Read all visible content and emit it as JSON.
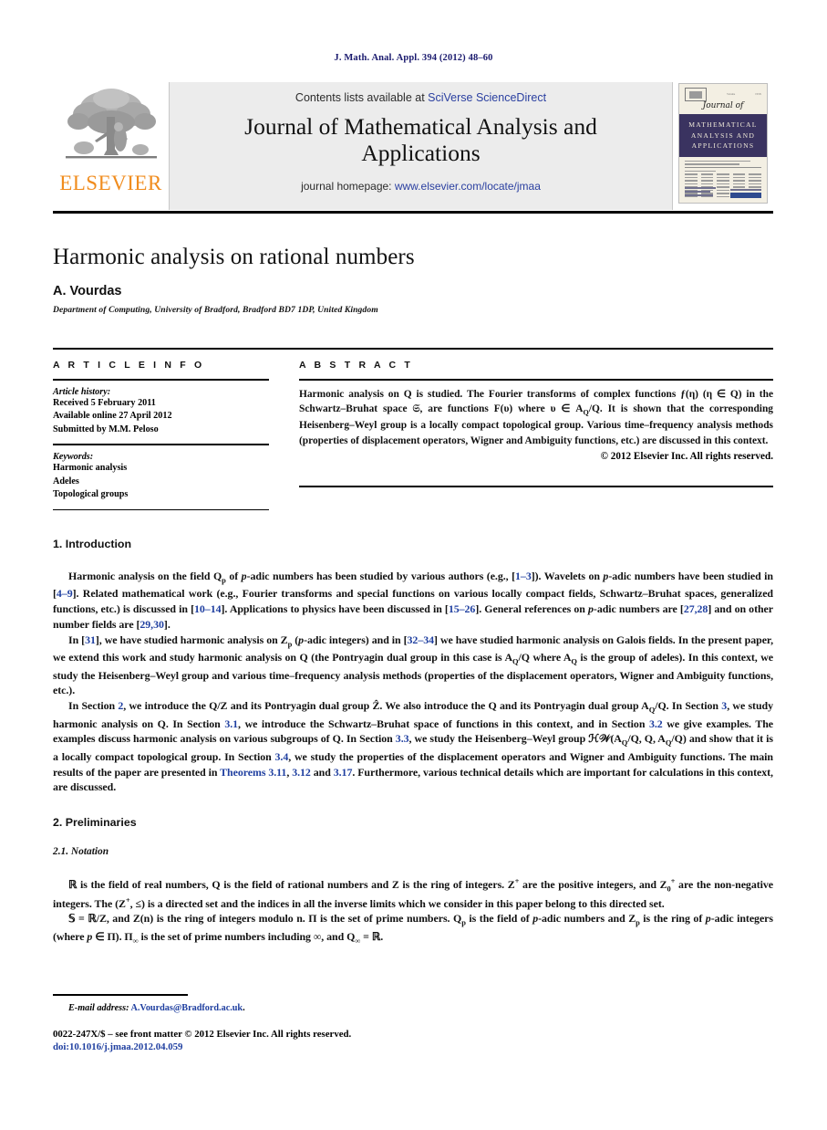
{
  "running_head": "J. Math. Anal. Appl. 394 (2012) 48–60",
  "masthead": {
    "publisher_name": "ELSEVIER",
    "publisher_logo": "elsevier-tree-logo",
    "contents_prefix": "Contents lists available at ",
    "contents_link": "SciVerse ScienceDirect",
    "journal_title": "Journal of Mathematical Analysis and Applications",
    "homepage_prefix": "journal homepage: ",
    "homepage_link": "www.elsevier.com/locate/jmaa",
    "cover": {
      "script_word": "Journal of",
      "band_line1": "MATHEMATICAL",
      "band_line2": "ANALYSIS AND",
      "band_line3": "APPLICATIONS",
      "band_color": "#3a3360",
      "paper_color": "#f3efe3"
    }
  },
  "article": {
    "title": "Harmonic analysis on rational numbers",
    "author": "A. Vourdas",
    "affiliation": "Department of Computing, University of Bradford, Bradford BD7 1DP, United Kingdom"
  },
  "article_info": {
    "heading": "A R T I C L E   I N F O",
    "history_heading": "Article history:",
    "history_lines": [
      "Received 5 February 2011",
      "Available online 27 April 2012",
      "Submitted by M.M. Peloso"
    ],
    "keywords_heading": "Keywords:",
    "keywords": [
      "Harmonic analysis",
      "Adeles",
      "Topological groups"
    ]
  },
  "abstract": {
    "heading": "A B S T R A C T",
    "text_parts": {
      "p1": "Harmonic analysis on Q is studied. The Fourier transforms of complex functions ƒ(η) (η ∈ Q) in the Schwartz–Bruhat space 𝔖, are functions F(υ) where υ ∈ A",
      "p1_sub": "Q",
      "p2": "/Q. It is shown that the corresponding Heisenberg–Weyl group is a locally compact topological group. Various time–frequency analysis methods (properties of displacement operators, Wigner and Ambiguity functions, etc.) are discussed in this context."
    },
    "copyright": "© 2012 Elsevier Inc. All rights reserved."
  },
  "sections": {
    "introduction": {
      "heading": "1. Introduction",
      "para1": {
        "a": "Harmonic analysis on the field Q",
        "a_sub": "p",
        "b": " of ",
        "b_i": "p",
        "c": "-adic numbers has been studied by various authors (e.g., [",
        "r1": "1–3",
        "d": "]). Wavelets on ",
        "d_i": "p",
        "e": "-adic numbers have been studied in [",
        "r2": "4–9",
        "f": "]. Related mathematical work (e.g., Fourier transforms and special functions on various locally compact fields, Schwartz–Bruhat spaces, generalized functions, etc.) is discussed in [",
        "r3": "10–14",
        "g": "]. Applications to physics have been discussed in [",
        "r4": "15–26",
        "h": "]. General references on ",
        "h_i": "p",
        "i": "-adic numbers are [",
        "r5": "27,28",
        "j": "] and on other number fields are [",
        "r6": "29,30",
        "k": "]."
      },
      "para2": {
        "a": "In [",
        "r1": "31",
        "b": "], we have studied harmonic analysis on Z",
        "b_sub": "p",
        "c": " (",
        "c_i": "p",
        "d": "-adic integers) and in [",
        "r2": "32–34",
        "e": "] we have studied harmonic analysis on Galois fields. In the present paper, we extend this work and study harmonic analysis on Q (the Pontryagin dual group in this case is A",
        "e_sub": "Q",
        "f": "/Q where A",
        "f_sub": "Q",
        "g": " is the group of adeles). In this context, we study the Heisenberg–Weyl group and various time–frequency analysis methods (properties of the displacement operators, Wigner and Ambiguity functions, etc.)."
      },
      "para3": {
        "a": "In Section ",
        "r1": "2",
        "b": ", we introduce the Q/Z and its Pontryagin dual group Ẑ. We also introduce the Q and its Pontryagin dual group A",
        "b_sub": "Q",
        "c": "/Q. In Section ",
        "r2": "3",
        "d": ", we study harmonic analysis on Q. In Section ",
        "r3": "3.1",
        "e": ", we introduce the Schwartz–Bruhat space of functions in this context, and in Section ",
        "r4": "3.2",
        "f": " we give examples. The examples discuss harmonic analysis on various subgroups of Q. In Section ",
        "r5": "3.3",
        "g": ", we study the Heisenberg–Weyl group ℋ𝒲(A",
        "g_sub": "Q",
        "h": "/Q, Q, A",
        "h_sub": "Q",
        "i": "/Q) and show that it is a locally compact topological group. In Section ",
        "r6": "3.4",
        "j": ", we study the properties of the displacement operators and Wigner and Ambiguity functions. The main results of the paper are presented in ",
        "r7": "Theorems 3.11",
        "k": ", ",
        "r8": "3.12",
        "l": " and ",
        "r9": "3.17",
        "m": ". Furthermore, various technical details which are important for calculations in this context, are discussed."
      }
    },
    "preliminaries": {
      "heading": "2. Preliminaries",
      "subheading": "2.1. Notation",
      "para1": {
        "a": "ℝ is the field of real numbers, Q is the field of rational numbers and Z is the ring of integers. Z",
        "a_sup": "+",
        "b": " are the positive integers, and Z",
        "b_sub": "0",
        "b_sup": "+",
        "c": " are the non-negative integers. The (Z",
        "c_sup": "+",
        "d": ", ≤) is a directed set and the indices in all the inverse limits which we consider in this paper belong to this directed set."
      },
      "para2": {
        "a": "𝕊 = ℝ/Z, and Z(n) is the ring of integers modulo n. Π is the set of prime numbers. Q",
        "a_sub": "p",
        "b": " is the field of ",
        "b_i": "p",
        "c": "-adic numbers and Z",
        "c_sub": "p",
        "d": " is the ring of ",
        "d_i": "p",
        "e": "-adic integers (where ",
        "e_i": "p",
        "f": " ∈ Π). Π",
        "f_sub": "∞",
        "g": " is the set of prime numbers including ∞, and Q",
        "g_sub": "∞",
        "h": " = ℝ."
      }
    }
  },
  "footnote": {
    "email_label": "E-mail address:",
    "email": "A.Vourdas@Bradford.ac.uk",
    "email_suffix": ".",
    "issn_line": "0022-247X/$ – see front matter © 2012 Elsevier Inc. All rights reserved.",
    "doi_line": "doi:10.1016/j.jmaa.2012.04.059"
  },
  "colors": {
    "link": "#1f3fa0",
    "elsevier_orange": "#F08C1E",
    "running_head": "#1a1a6e",
    "masthead_bg": "#ececec"
  }
}
